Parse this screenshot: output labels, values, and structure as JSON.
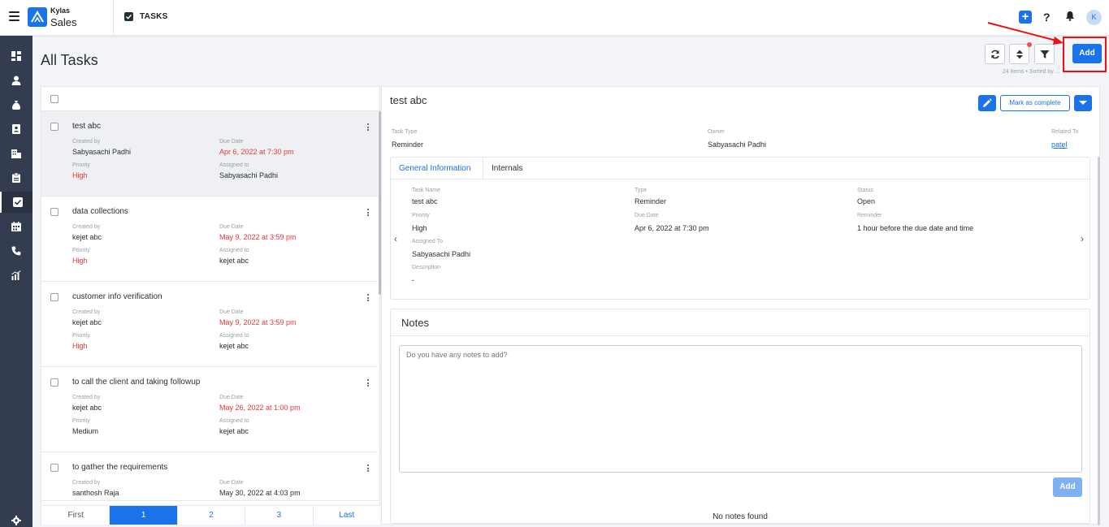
{
  "header": {
    "brand_top": "Kylas",
    "brand_bottom": "Sales",
    "module_title": "TASKS",
    "avatar_initial": "K",
    "help_label": "?"
  },
  "page": {
    "title": "All Tasks",
    "add_label": "Add",
    "meta": "24 items • Sorted by ..."
  },
  "list": {
    "tasks": [
      {
        "title": "test abc",
        "created_by": "Sabyasachi Padhi",
        "due_date": "Apr 6, 2022 at 7:30 pm",
        "priority": "High",
        "assigned_to": "Sabyasachi Padhi"
      },
      {
        "title": "data collections",
        "created_by": "kejet abc",
        "due_date": "May 9, 2022 at 3:59 pm",
        "priority": "High",
        "assigned_to": "kejet abc"
      },
      {
        "title": "customer info verification",
        "created_by": "kejet abc",
        "due_date": "May 9, 2022 at 3:59 pm",
        "priority": "High",
        "assigned_to": "kejet abc"
      },
      {
        "title": "to call the client and taking followup",
        "created_by": "kejet abc",
        "due_date": "May 26, 2022 at 1:00 pm",
        "priority": "Medium",
        "assigned_to": "kejet abc"
      },
      {
        "title": "to gather the requirements",
        "created_by": "santhosh Raja",
        "due_date": "May 30, 2022 at 4:03 pm",
        "priority": "",
        "assigned_to": ""
      }
    ],
    "labels": {
      "created_by": "Created by",
      "due_date": "Due Date",
      "priority": "Priority",
      "assigned_to": "Assigned to"
    },
    "pager": [
      "First",
      "1",
      "2",
      "3",
      "Last"
    ]
  },
  "detail": {
    "title": "test abc",
    "mark_complete": "Mark as complete",
    "summary": {
      "task_type_label": "Task Type",
      "task_type": "Reminder",
      "owner_label": "Owner",
      "owner": "Sabyasachi Padhi",
      "related_label": "Related To",
      "related": "patel"
    },
    "tabs": [
      "General Information",
      "Internals"
    ],
    "info": {
      "task_name_label": "Task Name",
      "task_name": "test abc",
      "type_label": "Type",
      "type": "Reminder",
      "status_label": "Status",
      "status": "Open",
      "priority_label": "Priority",
      "priority": "High",
      "due_label": "Due Date",
      "due": "Apr 6, 2022 at 7:30 pm",
      "reminder_label": "Reminder",
      "reminder": "1 hour before the due date and time",
      "assigned_label": "Assigned To",
      "assigned": "Sabyasachi Padhi",
      "desc_label": "Description",
      "desc": "-"
    },
    "notes": {
      "title": "Notes",
      "placeholder": "Do you have any notes to add?",
      "add_label": "Add",
      "empty": "No notes found"
    }
  },
  "colors": {
    "accent": "#1a73e8",
    "sidebar": "#343d4f",
    "due_red": "#e53935",
    "highlight": "#ee1111"
  }
}
